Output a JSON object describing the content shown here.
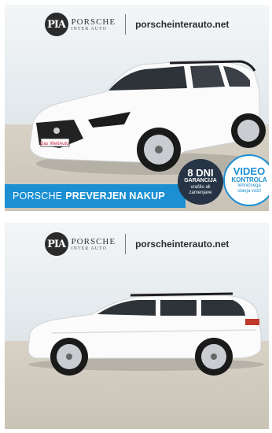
{
  "brand": {
    "mark": "PIA",
    "name_line1": "PORSCHE",
    "name_line2": "INTER AUTO",
    "website": "porscheinterauto.net"
  },
  "banner": {
    "text_regular": "PORSCHE",
    "text_bold": "PREVERJEN NAKUP"
  },
  "badges": {
    "guarantee": {
      "big": "8 DNI",
      "mid": "GARANCIJA",
      "small_1": "vračilo ali",
      "small_2": "zamenjave"
    },
    "video": {
      "big_1": "VIDEO",
      "big_2": "KONTROLA",
      "small_1": "tehničnega",
      "small_2": "stanja vozil"
    }
  },
  "plates": {
    "front": "Das WeltAuto."
  },
  "colors": {
    "banner_blue": "#1b8fd2",
    "badge_dark": "#263445",
    "car_body": "#ffffff"
  }
}
